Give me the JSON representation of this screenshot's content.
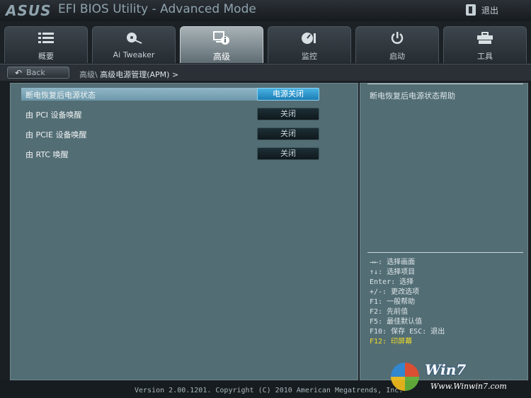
{
  "titlebar": {
    "brand": "ASUS",
    "title": "EFI BIOS Utility - Advanced Mode",
    "exit_label": "退出"
  },
  "tabs": [
    {
      "label": "概要",
      "icon": "list-icon"
    },
    {
      "label": "Ai Tweaker",
      "icon": "fan-icon"
    },
    {
      "label": "高级",
      "icon": "advanced-info-icon"
    },
    {
      "label": "监控",
      "icon": "gauge-icon"
    },
    {
      "label": "启动",
      "icon": "power-icon"
    },
    {
      "label": "工具",
      "icon": "tools-icon"
    }
  ],
  "active_tab": "高级",
  "breadcrumb": {
    "back_label": "Back",
    "root": "高级\\",
    "current": "高级电源管理(APM) >"
  },
  "settings": [
    {
      "label": "断电恢复后电源状态",
      "value": "电源关闭",
      "selected": true
    },
    {
      "label": "由 PCI 设备唤醒",
      "value": "关闭",
      "selected": false
    },
    {
      "label": "由 PCIE 设备唤醒",
      "value": "关闭",
      "selected": false
    },
    {
      "label": "由 RTC 唤醒",
      "value": "关闭",
      "selected": false
    }
  ],
  "help": {
    "text": "断电恢复后电源状态帮助",
    "keys": [
      {
        "text": "→←: 选择画面",
        "highlight": false
      },
      {
        "text": "↑↓: 选择项目",
        "highlight": false
      },
      {
        "text": "Enter: 选择",
        "highlight": false
      },
      {
        "text": "+/-: 更改选项",
        "highlight": false
      },
      {
        "text": "F1: 一般帮助",
        "highlight": false
      },
      {
        "text": "F2: 先前值",
        "highlight": false
      },
      {
        "text": "F5: 最佳默认值",
        "highlight": false
      },
      {
        "text": "F10: 保存  ESC: 退出",
        "highlight": false
      },
      {
        "text": "F12: 印屏幕",
        "highlight": true
      }
    ]
  },
  "footer": {
    "version": "Version 2.00.1201. Copyright (C) 2010 American Megatrends, Inc."
  },
  "watermark": {
    "brand": "Win7",
    "url": "Www.Winwin7.com"
  },
  "colors": {
    "panel": "#536d74",
    "selected_value": "#2a8fc9",
    "highlight_key": "#f3df28"
  }
}
